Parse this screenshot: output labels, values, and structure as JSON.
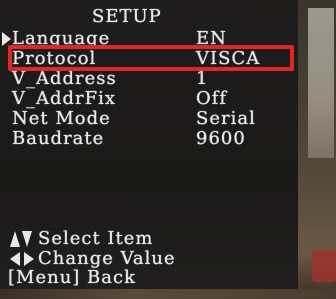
{
  "osd": {
    "title": "SETUP",
    "items": [
      {
        "label": "Language",
        "value": "EN"
      },
      {
        "label": "Protocol",
        "value": "VISCA"
      },
      {
        "label": "V_Address",
        "value": "1"
      },
      {
        "label": "V_AddrFix",
        "value": "Off"
      },
      {
        "label": "Net Mode",
        "value": "Serial"
      },
      {
        "label": "Baudrate",
        "value": "9600"
      }
    ],
    "cursor_icon": "right-triangle-cursor-icon",
    "highlighted_item": "Protocol",
    "highlight_color": "#e32525"
  },
  "help": {
    "select": "Select Item",
    "change": "Change Value",
    "back": "[Menu] Back",
    "select_icon": "up-down-arrows-icon",
    "change_icon": "left-right-arrows-icon"
  }
}
